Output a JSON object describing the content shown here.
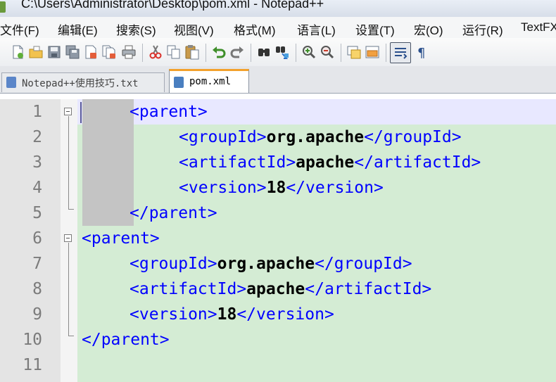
{
  "window": {
    "title": "C:\\Users\\Administrator\\Desktop\\pom.xml - Notepad++"
  },
  "menu": [
    "文件(F)",
    "编辑(E)",
    "搜索(S)",
    "视图(V)",
    "格式(M)",
    "语言(L)",
    "设置(T)",
    "宏(O)",
    "运行(R)",
    "TextFX"
  ],
  "toolbar": {
    "icons": [
      "new-file-icon",
      "open-file-icon",
      "save-icon",
      "save-all-icon",
      "close-icon",
      "close-all-icon",
      "print-icon",
      "cut-icon",
      "copy-icon",
      "paste-icon",
      "undo-icon",
      "redo-icon",
      "find-icon",
      "replace-icon",
      "zoom-in-icon",
      "zoom-out-icon",
      "sync-vertical-icon",
      "sync-horizontal-icon",
      "word-wrap-icon",
      "show-all-chars-icon"
    ]
  },
  "tabs": [
    {
      "label": "Notepad++使用技巧.txt",
      "active": false
    },
    {
      "label": "pom.xml",
      "active": true
    }
  ],
  "editor": {
    "line_numbers": [
      "1",
      "2",
      "3",
      "4",
      "5",
      "6",
      "7",
      "8",
      "9",
      "10",
      "11"
    ],
    "lines": [
      [
        {
          "t": "<parent>",
          "c": "tag"
        }
      ],
      [
        {
          "t": "<groupId>",
          "c": "tag"
        },
        {
          "t": "org.apache",
          "c": "val"
        },
        {
          "t": "</groupId>",
          "c": "tag"
        }
      ],
      [
        {
          "t": "<artifactId>",
          "c": "tag"
        },
        {
          "t": "apache",
          "c": "val"
        },
        {
          "t": "</artifactId>",
          "c": "tag"
        }
      ],
      [
        {
          "t": "<version>",
          "c": "tag"
        },
        {
          "t": "18",
          "c": "val"
        },
        {
          "t": "</version>",
          "c": "tag"
        }
      ],
      [
        {
          "t": "</parent>",
          "c": "tag"
        }
      ],
      [
        {
          "t": "<parent>",
          "c": "tag"
        }
      ],
      [
        {
          "t": "<groupId>",
          "c": "tag"
        },
        {
          "t": "org.apache",
          "c": "val"
        },
        {
          "t": "</groupId>",
          "c": "tag"
        }
      ],
      [
        {
          "t": "<artifactId>",
          "c": "tag"
        },
        {
          "t": "apache",
          "c": "val"
        },
        {
          "t": "</artifactId>",
          "c": "tag"
        }
      ],
      [
        {
          "t": "<version>",
          "c": "tag"
        },
        {
          "t": "18",
          "c": "val"
        },
        {
          "t": "</version>",
          "c": "tag"
        }
      ],
      [
        {
          "t": "</parent>",
          "c": "tag"
        }
      ],
      []
    ]
  },
  "colors": {
    "tag": "#0000ff",
    "value": "#000000",
    "selection_bg": "#d4ecd4",
    "current_line_bg": "#e8e8ff",
    "gutter_bg": "#e4e4e4",
    "active_tab_accent": "#f3a12c"
  }
}
